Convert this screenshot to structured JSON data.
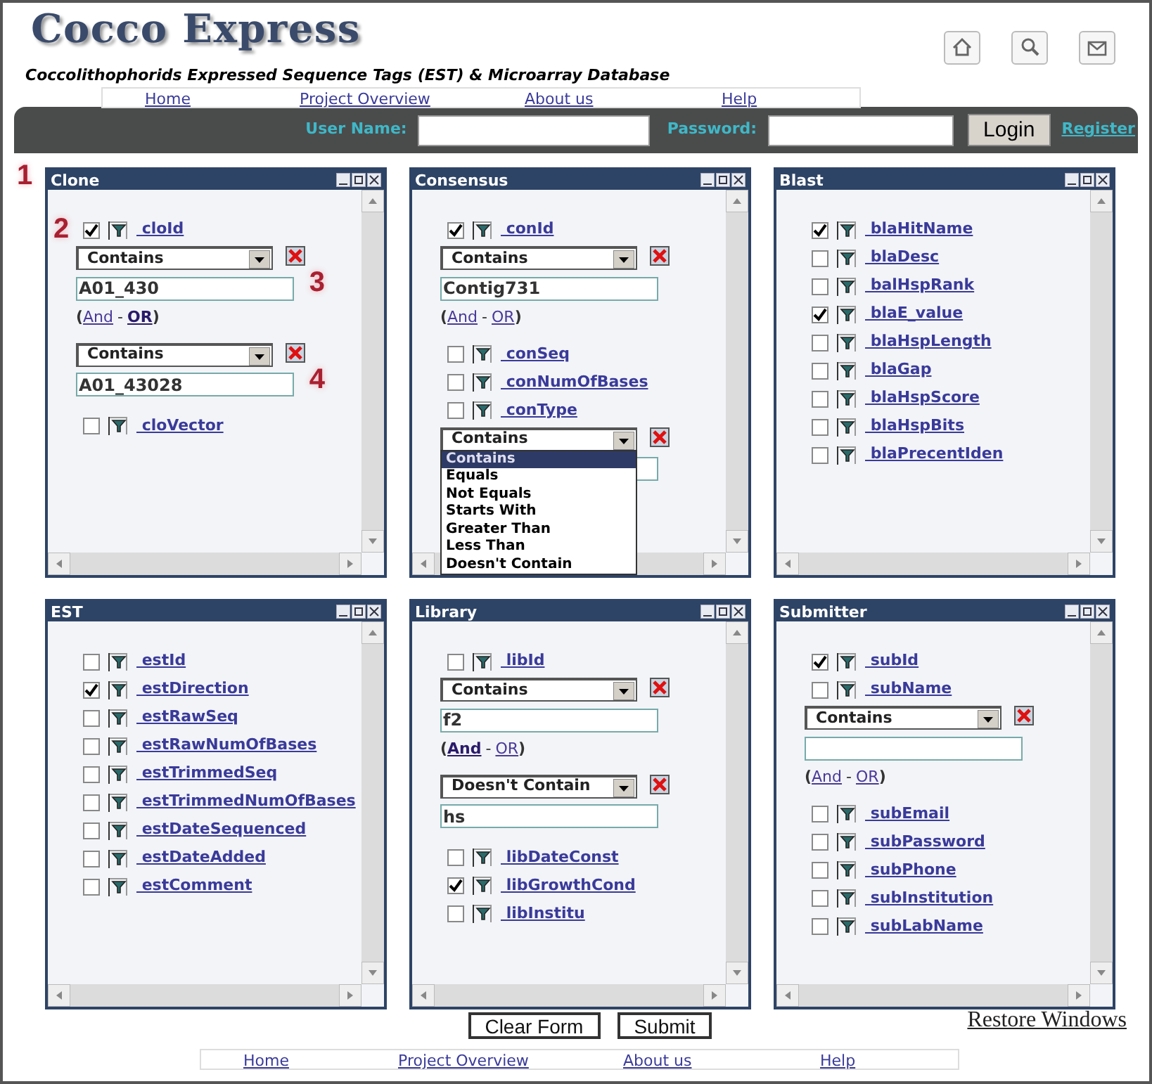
{
  "header": {
    "logo": "Cocco Express",
    "subtitle": "Coccolithophorids Expressed Sequence Tags (EST) & Microarray Database"
  },
  "nav": [
    "Home",
    "Project Overview",
    "About us",
    "Help"
  ],
  "login": {
    "user_label": "User Name:",
    "password_label": "Password:",
    "button": "Login",
    "register": "Register"
  },
  "panels": [
    {
      "title": "Clone",
      "marker": "1",
      "rows": [
        {
          "kind": "field",
          "label": "cloId",
          "checked": true,
          "marker": "2"
        },
        {
          "kind": "filter",
          "operator": "Contains",
          "value": "A01_430",
          "marker": "3",
          "logic": {
            "open": "(",
            "and": "And",
            "dash": "-",
            "or": "OR",
            "close": ")",
            "and_bold": false,
            "or_bold": true
          }
        },
        {
          "kind": "filter",
          "operator": "Contains",
          "value": "A01_43028",
          "marker": "4"
        },
        {
          "kind": "field",
          "label": "cloVector",
          "checked": false
        }
      ]
    },
    {
      "title": "Consensus",
      "rows": [
        {
          "kind": "field",
          "label": "conId",
          "checked": true
        },
        {
          "kind": "filter",
          "operator": "Contains",
          "value": "Contig731",
          "logic": {
            "open": "(",
            "and": "And",
            "dash": "-",
            "or": "OR",
            "close": ")",
            "and_bold": false,
            "or_bold": false
          }
        },
        {
          "kind": "field",
          "label": "conSeq",
          "checked": false
        },
        {
          "kind": "field",
          "label": "conNumOfBases",
          "checked": false
        },
        {
          "kind": "field",
          "label": "conType",
          "checked": false
        },
        {
          "kind": "filter",
          "operator": "Contains",
          "options": [
            {
              "label": "Contains",
              "selected": true
            },
            {
              "label": "Equals",
              "selected": false
            },
            {
              "label": "Not Equals",
              "selected": false
            },
            {
              "label": "Starts With",
              "selected": false
            },
            {
              "label": "Greater Than",
              "selected": false
            },
            {
              "label": "Less Than",
              "selected": false
            },
            {
              "label": "Doesn't Contain",
              "selected": false
            }
          ]
        }
      ]
    },
    {
      "title": "Blast",
      "rows": [
        {
          "kind": "field",
          "label": "blaHitName",
          "checked": true
        },
        {
          "kind": "field",
          "label": "blaDesc",
          "checked": false
        },
        {
          "kind": "field",
          "label": "balHspRank",
          "checked": false
        },
        {
          "kind": "field",
          "label": "blaE_value",
          "checked": true
        },
        {
          "kind": "field",
          "label": "blaHspLength",
          "checked": false
        },
        {
          "kind": "field",
          "label": "blaGap",
          "checked": false
        },
        {
          "kind": "field",
          "label": "blaHspScore",
          "checked": false
        },
        {
          "kind": "field",
          "label": "blaHspBits",
          "checked": false
        },
        {
          "kind": "field",
          "label": "blaPrecentIden",
          "checked": false
        }
      ]
    },
    {
      "title": "EST",
      "rows": [
        {
          "kind": "field",
          "label": "estId",
          "checked": false
        },
        {
          "kind": "field",
          "label": "estDirection",
          "checked": true
        },
        {
          "kind": "field",
          "label": "estRawSeq",
          "checked": false
        },
        {
          "kind": "field",
          "label": "estRawNumOfBases",
          "checked": false
        },
        {
          "kind": "field",
          "label": "estTrimmedSeq",
          "checked": false
        },
        {
          "kind": "field",
          "label": "estTrimmedNumOfBases",
          "checked": false
        },
        {
          "kind": "field",
          "label": "estDateSequenced",
          "checked": false
        },
        {
          "kind": "field",
          "label": "estDateAdded",
          "checked": false
        },
        {
          "kind": "field",
          "label": "estComment",
          "checked": false
        }
      ]
    },
    {
      "title": "Library",
      "rows": [
        {
          "kind": "field",
          "label": "libId",
          "checked": false
        },
        {
          "kind": "filter",
          "operator": "Contains",
          "value": "f2",
          "logic": {
            "open": "(",
            "and": "And",
            "dash": "-",
            "or": "OR",
            "close": ")",
            "and_bold": true,
            "or_bold": false
          }
        },
        {
          "kind": "filter",
          "operator": "Doesn't Contain",
          "value": "hs"
        },
        {
          "kind": "field",
          "label": "libDateConst",
          "checked": false
        },
        {
          "kind": "field",
          "label": "libGrowthCond",
          "checked": true
        },
        {
          "kind": "field",
          "label": "libInstitu",
          "checked": false
        }
      ]
    },
    {
      "title": "Submitter",
      "rows": [
        {
          "kind": "field",
          "label": "subId",
          "checked": true
        },
        {
          "kind": "field",
          "label": "subName",
          "checked": false
        },
        {
          "kind": "filter",
          "operator": "Contains",
          "logic": {
            "open": "(",
            "and": "And",
            "dash": "-",
            "or": "OR",
            "close": ")",
            "and_bold": false,
            "or_bold": false
          }
        },
        {
          "kind": "field",
          "label": "subEmail",
          "checked": false
        },
        {
          "kind": "field",
          "label": "subPassword",
          "checked": false
        },
        {
          "kind": "field",
          "label": "subPhone",
          "checked": false
        },
        {
          "kind": "field",
          "label": "subInstitution",
          "checked": false
        },
        {
          "kind": "field",
          "label": "subLabName",
          "checked": false
        }
      ]
    }
  ],
  "actions": [
    "Clear Form",
    "Submit"
  ],
  "restore": "Restore Windows",
  "footer_nav": [
    "Home",
    "Project Overview",
    "About us",
    "Help"
  ]
}
